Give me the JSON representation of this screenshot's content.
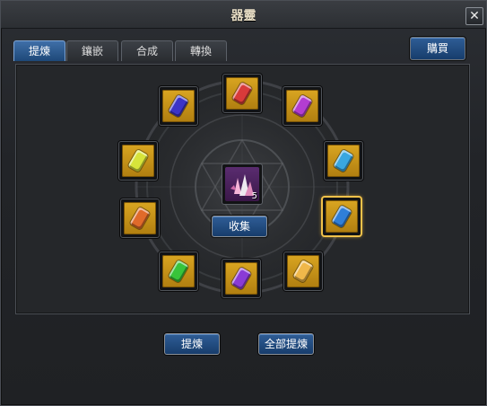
{
  "window": {
    "title": "器靈",
    "close_symbol": "✕"
  },
  "tabs": [
    {
      "label": "提煉",
      "active": true
    },
    {
      "label": "鑲嵌",
      "active": false
    },
    {
      "label": "合成",
      "active": false
    },
    {
      "label": "轉換",
      "active": false
    }
  ],
  "buy_label": "購買",
  "center": {
    "item": "crystal-cluster-icon",
    "count": "5",
    "collect_label": "收集"
  },
  "gem_slots": [
    {
      "id": "top-left",
      "color": "#3b34c8",
      "selected": false
    },
    {
      "id": "top",
      "color": "#d83a3a",
      "selected": false
    },
    {
      "id": "top-right",
      "color": "#b33dd1",
      "selected": false
    },
    {
      "id": "left-upper",
      "color": "#d7e43a",
      "selected": false
    },
    {
      "id": "right-upper",
      "color": "#39a7e0",
      "selected": false
    },
    {
      "id": "left-lower",
      "color": "#e06a2a",
      "selected": false
    },
    {
      "id": "right-lower",
      "color": "#2f7fd8",
      "selected": true
    },
    {
      "id": "bottom-left",
      "color": "#38c43a",
      "selected": false
    },
    {
      "id": "bottom",
      "color": "#8a3bd6",
      "selected": false
    },
    {
      "id": "bottom-right",
      "color": "#f0b84a",
      "selected": false
    }
  ],
  "actions": {
    "refine_label": "提煉",
    "refine_all_label": "全部提煉"
  },
  "colors": {
    "accent": "#2f5d96",
    "slot_gold": "#d9a521",
    "selection": "#f0c14a"
  }
}
